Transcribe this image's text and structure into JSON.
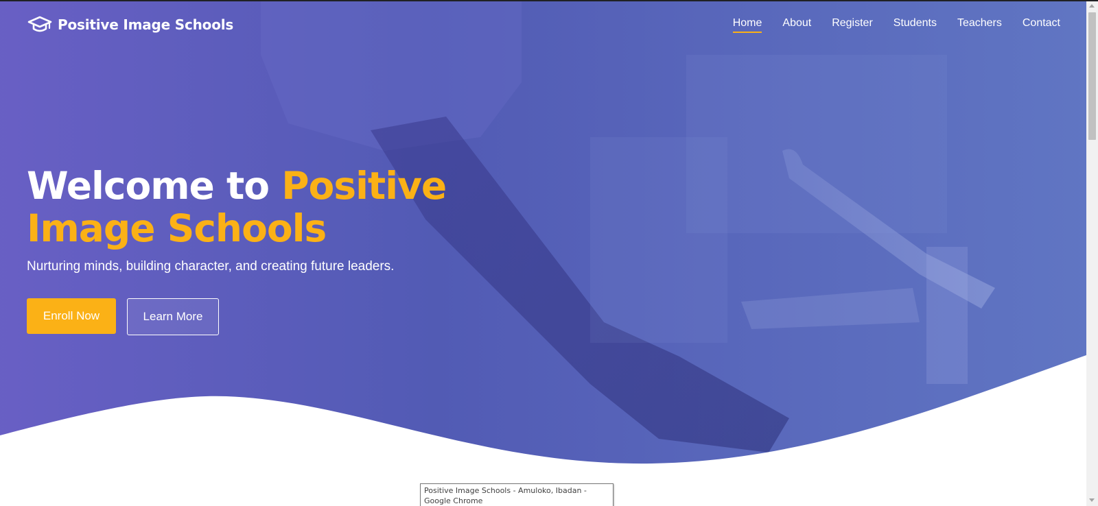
{
  "site": {
    "logo_text": "Positive Image Schools",
    "logo_icon": "graduation-cap-icon"
  },
  "nav": {
    "items": [
      {
        "label": "Home",
        "active": true
      },
      {
        "label": "About",
        "active": false
      },
      {
        "label": "Register",
        "active": false
      },
      {
        "label": "Students",
        "active": false
      },
      {
        "label": "Teachers",
        "active": false
      },
      {
        "label": "Contact",
        "active": false
      }
    ]
  },
  "hero": {
    "title_white": "Welcome to ",
    "title_accent_1": "Positive",
    "title_accent_2": "Image Schools",
    "subtitle": "Nurturing minds, building character, and creating future leaders.",
    "primary_button": "Enroll Now",
    "secondary_button": "Learn More"
  },
  "tooltip": {
    "text": "Positive Image Schools - Amuloko, Ibadan - Google Chrome"
  },
  "colors": {
    "accent": "#fbb116",
    "hero_overlay": "#3a44aa",
    "text_light": "#ffffff"
  }
}
